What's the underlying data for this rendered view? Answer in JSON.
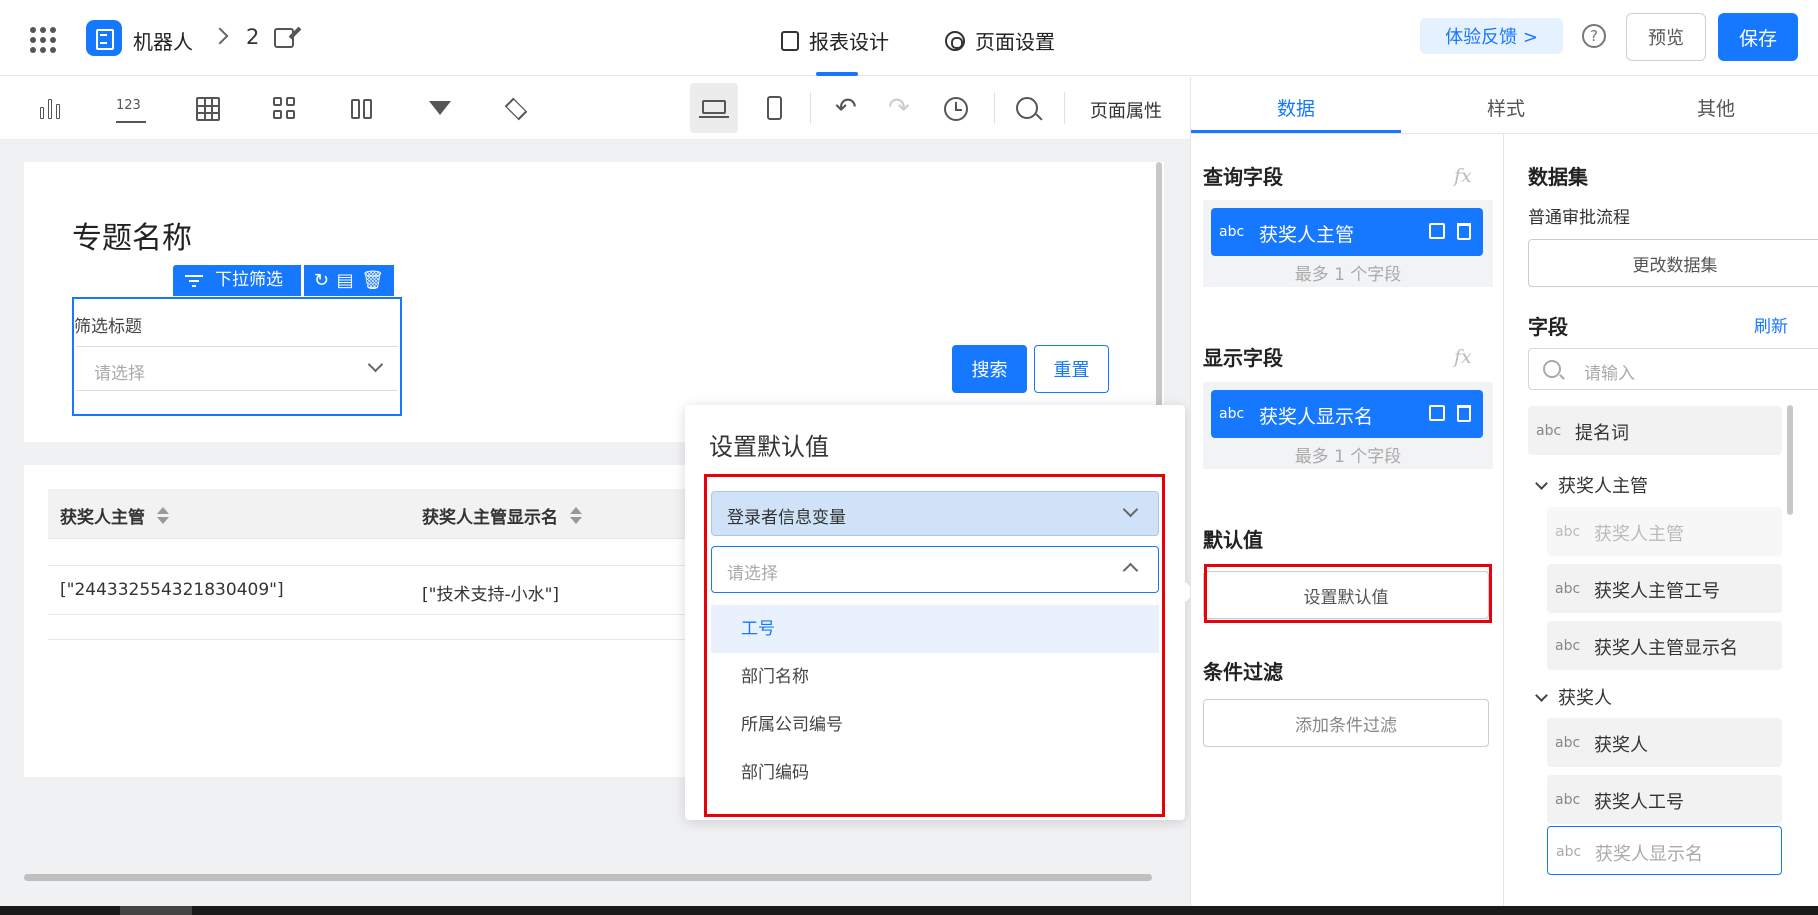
{
  "header": {
    "app_name": "机器人",
    "crumb": "2",
    "tabs": [
      {
        "label": "报表设计",
        "icon": "report-design-icon",
        "active": true
      },
      {
        "label": "页面设置",
        "icon": "gear-icon",
        "active": false
      }
    ],
    "feedback": "体验反馈 >",
    "help": "?",
    "preview": "预览",
    "save": "保存"
  },
  "toolbar": {
    "tools": [
      "bar-chart-icon",
      "number-icon",
      "table-icon",
      "blocks-icon",
      "columns-icon",
      "filter-icon",
      "layers-icon"
    ],
    "num_glyph": "123",
    "undo_glyph": "↶",
    "redo_glyph": "↷",
    "page_props": "页面属性"
  },
  "canvas": {
    "page_title": "专题名称",
    "filter_widget": {
      "tag": "下拉筛选",
      "icons": [
        "↻",
        "▤",
        "🗑"
      ],
      "title": "筛选标题",
      "placeholder": "请选择"
    },
    "search_btn": "搜索",
    "reset_btn": "重置",
    "table": {
      "headers": [
        "获奖人主管",
        "获奖人主管显示名"
      ],
      "rows": [
        [
          "[\"244332554321830409\"]",
          "[\"技术支持-小水\"]"
        ]
      ]
    }
  },
  "popup": {
    "title": "设置默认值",
    "variable_select": "登录者信息变量",
    "attr_placeholder": "请选择",
    "options": [
      "工号",
      "部门名称",
      "所属公司编号",
      "部门编码"
    ],
    "active_option": 0
  },
  "panel": {
    "tabs": [
      "数据",
      "样式",
      "其他"
    ],
    "active_tab": 0,
    "query_field": {
      "title": "查询字段",
      "fx": "fx",
      "chip_type": "abc",
      "chip_name": "获奖人主管",
      "note": "最多 1 个字段"
    },
    "display_field": {
      "title": "显示字段",
      "fx": "fx",
      "chip_type": "abc",
      "chip_name": "获奖人显示名",
      "note": "最多 1 个字段"
    },
    "default_value": {
      "title": "默认值",
      "button": "设置默认值"
    },
    "condition": {
      "title": "条件过滤",
      "button": "添加条件过滤"
    },
    "dataset": {
      "title": "数据集",
      "name": "普通审批流程",
      "button": "更改数据集"
    },
    "fields": {
      "title": "字段",
      "refresh": "刷新",
      "search_placeholder": "请输入",
      "top_item": {
        "type": "abc",
        "name": "提名词"
      },
      "groups": [
        {
          "name": "获奖人主管",
          "items": [
            {
              "type": "abc",
              "name": "获奖人主管",
              "state": "dim"
            },
            {
              "type": "abc",
              "name": "获奖人主管工号",
              "state": "normal"
            },
            {
              "type": "abc",
              "name": "获奖人主管显示名",
              "state": "normal"
            }
          ]
        },
        {
          "name": "获奖人",
          "items": [
            {
              "type": "abc",
              "name": "获奖人",
              "state": "normal"
            },
            {
              "type": "abc",
              "name": "获奖人工号",
              "state": "normal"
            },
            {
              "type": "abc",
              "name": "获奖人显示名",
              "state": "highlight"
            }
          ]
        }
      ]
    }
  },
  "colors": {
    "accent": "#1677ff",
    "highlight_border": "#e8000b"
  }
}
